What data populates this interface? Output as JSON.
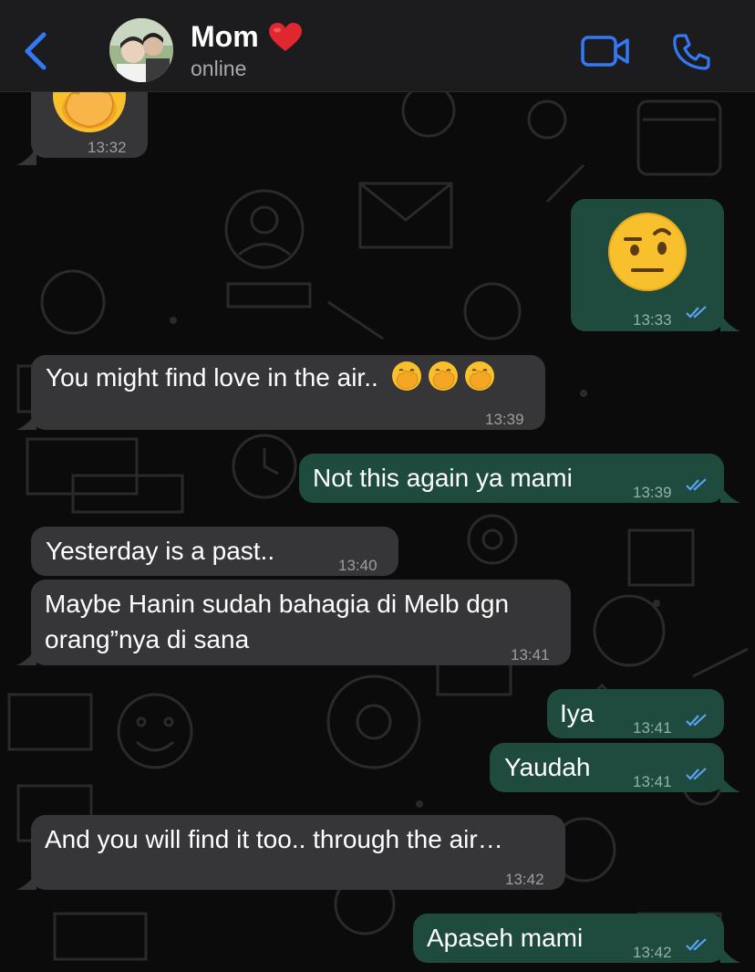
{
  "header": {
    "back_icon": "chevron-left-icon",
    "contact_name": "Mom",
    "name_emoji": "red-heart-icon",
    "status": "online",
    "video_icon": "video-call-icon",
    "phone_icon": "phone-call-icon",
    "accent": "#3478f6"
  },
  "colors": {
    "incoming_bubble": "#363638",
    "outgoing_bubble": "#1f4b3f",
    "read_ticks": "#5aa2f5"
  },
  "messages": [
    {
      "direction": "in",
      "emoji": "hand-over-mouth-emoji",
      "time": "13:32"
    },
    {
      "direction": "out",
      "emoji": "raised-eyebrow-emoji",
      "time": "13:33",
      "read": true
    },
    {
      "direction": "in",
      "text": "You might find love in the air..",
      "emojis": [
        "hand-over-mouth-emoji",
        "hand-over-mouth-emoji",
        "hand-over-mouth-emoji"
      ],
      "time": "13:39"
    },
    {
      "direction": "out",
      "text": "Not this again ya mami",
      "time": "13:39",
      "read": true
    },
    {
      "direction": "in",
      "text": "Yesterday is a past..",
      "time": "13:40"
    },
    {
      "direction": "in",
      "text_line1": "Maybe Hanin sudah bahagia di Melb dgn",
      "text_line2": "orang”nya di sana",
      "time": "13:41"
    },
    {
      "direction": "out",
      "text": "Iya",
      "time": "13:41",
      "read": true
    },
    {
      "direction": "out",
      "text": "Yaudah",
      "time": "13:41",
      "read": true
    },
    {
      "direction": "in",
      "text": "And you will find it too.. through the air…",
      "time": "13:42"
    },
    {
      "direction": "out",
      "text": "Apaseh mami",
      "time": "13:42",
      "read": true
    }
  ]
}
